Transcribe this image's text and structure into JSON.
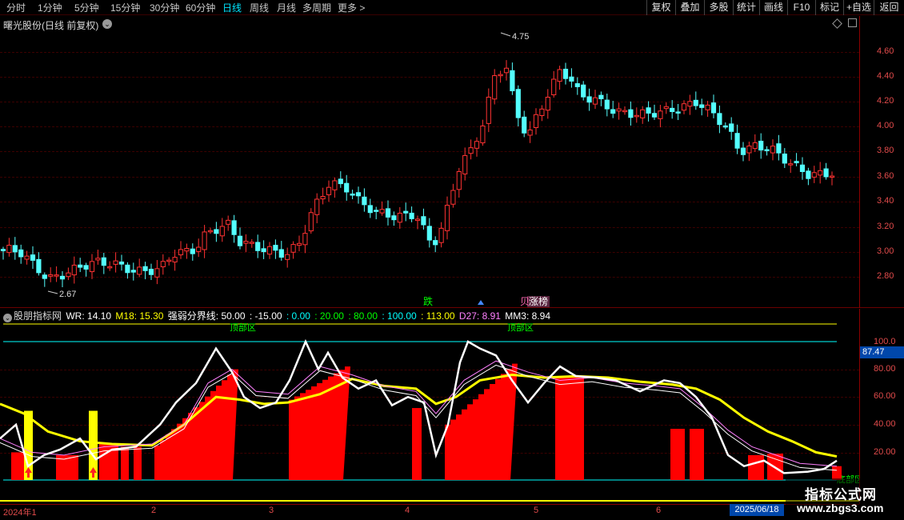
{
  "toolbar": {
    "periods": [
      {
        "label": "分时",
        "active": false
      },
      {
        "label": "1分钟",
        "active": false
      },
      {
        "label": "5分钟",
        "active": false
      },
      {
        "label": "15分钟",
        "active": false
      },
      {
        "label": "30分钟",
        "active": false
      },
      {
        "label": "60分钟",
        "active": false
      },
      {
        "label": "日线",
        "active": true
      },
      {
        "label": "周线",
        "active": false
      },
      {
        "label": "月线",
        "active": false
      },
      {
        "label": "多周期",
        "active": false
      },
      {
        "label": "更多 >",
        "active": false
      }
    ],
    "right_buttons": [
      "复权",
      "叠加",
      "多股",
      "统计",
      "画线",
      "F10",
      "标记",
      "+自选",
      "返回"
    ]
  },
  "main_chart": {
    "title": "曙光股份(日线 前复权)",
    "y_ticks": [
      "4.60",
      "4.40",
      "4.20",
      "4.00",
      "3.80",
      "3.60",
      "3.40",
      "3.20",
      "3.00",
      "2.80"
    ],
    "high_label": "4.75",
    "low_label": "2.67",
    "markers": [
      {
        "text": "跌",
        "color": "#00ff00"
      },
      {
        "text": "贝",
        "color": "#ff69b4"
      },
      {
        "text": "涨榜",
        "color": "#ff69b4"
      }
    ]
  },
  "indicator": {
    "name": "股朋指标网",
    "values": [
      {
        "label": "WR: 14.10",
        "color": "#ffffff"
      },
      {
        "label": "M18: 15.30",
        "color": "#ffff00"
      },
      {
        "label": "强弱分界线: 50.00",
        "color": "#ffffff"
      },
      {
        "label": ": -15.00",
        "color": "#ffffff"
      },
      {
        "label": ": 0.00",
        "color": "#00ffff"
      },
      {
        "label": ": 20.00",
        "color": "#00ff00"
      },
      {
        "label": ": 80.00",
        "color": "#00ff00"
      },
      {
        "label": ": 100.00",
        "color": "#00ffff"
      },
      {
        "label": ": 113.00",
        "color": "#ffff00"
      },
      {
        "label": "D27: 8.91",
        "color": "#ff80ff"
      },
      {
        "label": "MM3: 8.94",
        "color": "#ffffff"
      }
    ],
    "y_ticks": [
      "100.0",
      "80.00",
      "60.00",
      "40.00",
      "20.00"
    ],
    "top_zone_label": "顶部区",
    "bottom_zone_label": "底部区",
    "crosshair_value": "87.47"
  },
  "date_axis": {
    "labels": [
      "2024年1",
      "2",
      "3",
      "4",
      "5",
      "6"
    ],
    "crosshair_date": "2025/06/18"
  },
  "watermark": {
    "title": "指标公式网",
    "url": "www.zbgs3.com"
  },
  "colors": {
    "up": "#ff3232",
    "down": "#54ffff",
    "bg": "#000000",
    "wr": "#ffffff",
    "m18": "#ffff00",
    "bar": "#ff0000"
  }
}
